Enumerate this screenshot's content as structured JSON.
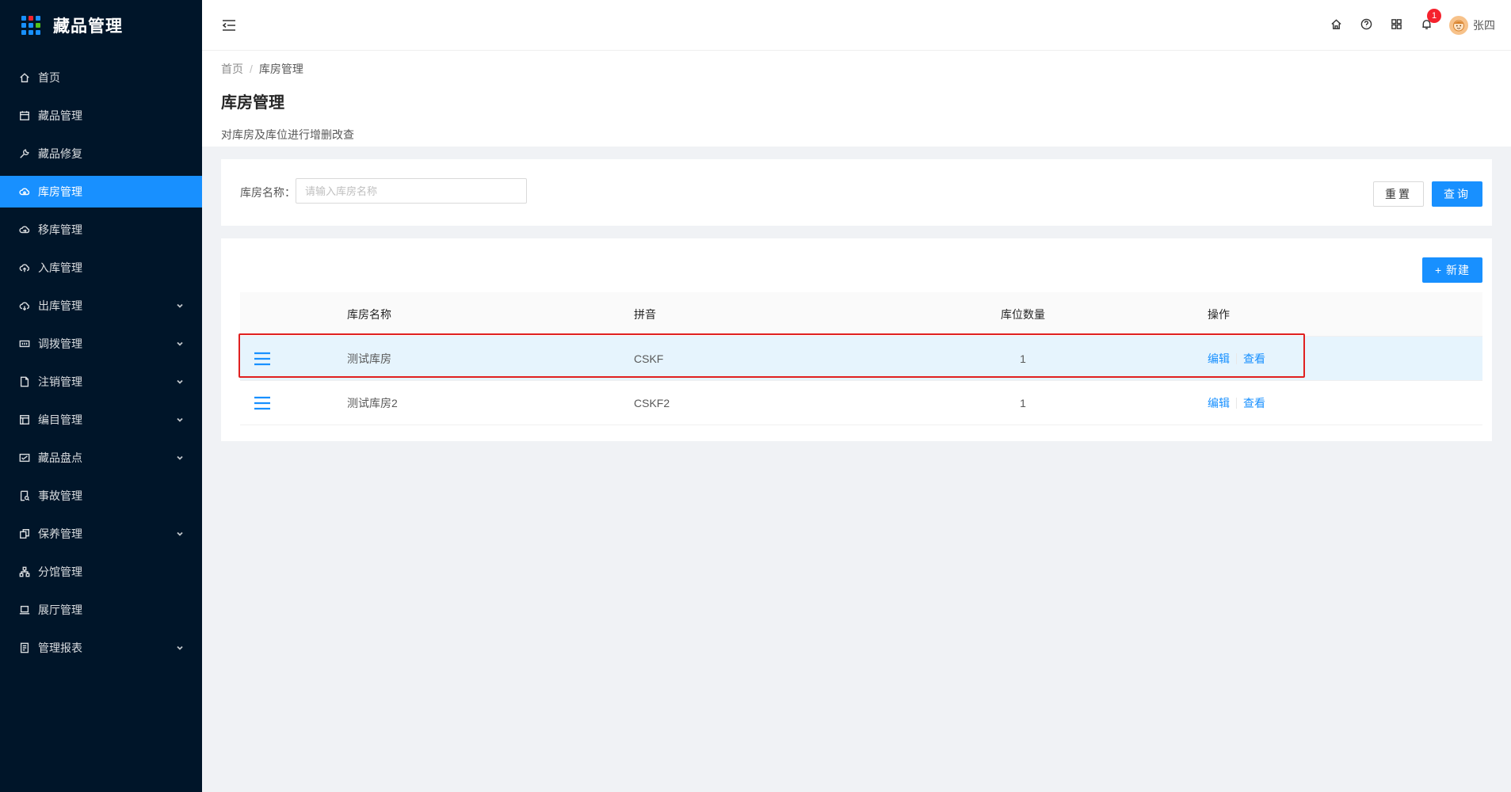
{
  "app": {
    "title": "藏品管理"
  },
  "sidebar": {
    "items": [
      {
        "label": "首页",
        "icon": "home-icon",
        "has_arrow": false,
        "active": false
      },
      {
        "label": "藏品管理",
        "icon": "calendar-icon",
        "has_arrow": false,
        "active": false
      },
      {
        "label": "藏品修复",
        "icon": "wrench-icon",
        "has_arrow": false,
        "active": false
      },
      {
        "label": "库房管理",
        "icon": "cloud-icon",
        "has_arrow": false,
        "active": true
      },
      {
        "label": "移库管理",
        "icon": "cloud-sync-icon",
        "has_arrow": false,
        "active": false
      },
      {
        "label": "入库管理",
        "icon": "cloud-upload-icon",
        "has_arrow": false,
        "active": false
      },
      {
        "label": "出库管理",
        "icon": "cloud-download-icon",
        "has_arrow": true,
        "active": false
      },
      {
        "label": "调拨管理",
        "icon": "transfer-icon",
        "has_arrow": true,
        "active": false
      },
      {
        "label": "注销管理",
        "icon": "file-icon",
        "has_arrow": true,
        "active": false
      },
      {
        "label": "编目管理",
        "icon": "catalog-icon",
        "has_arrow": true,
        "active": false
      },
      {
        "label": "藏品盘点",
        "icon": "inventory-icon",
        "has_arrow": true,
        "active": false
      },
      {
        "label": "事故管理",
        "icon": "file-search-icon",
        "has_arrow": false,
        "active": false
      },
      {
        "label": "保养管理",
        "icon": "maintain-icon",
        "has_arrow": true,
        "active": false
      },
      {
        "label": "分馆管理",
        "icon": "cluster-icon",
        "has_arrow": false,
        "active": false
      },
      {
        "label": "展厅管理",
        "icon": "laptop-icon",
        "has_arrow": false,
        "active": false
      },
      {
        "label": "管理报表",
        "icon": "report-icon",
        "has_arrow": true,
        "active": false
      }
    ]
  },
  "header": {
    "notification_count": "1",
    "username": "张四"
  },
  "breadcrumb": {
    "home": "首页",
    "sep": "/",
    "current": "库房管理"
  },
  "page": {
    "title": "库房管理",
    "description": "对库房及库位进行增删改查"
  },
  "search": {
    "label": "库房名称：",
    "placeholder": "请输入库房名称",
    "value": "",
    "reset_label": "重置",
    "query_label": "查询"
  },
  "table": {
    "new_label": "+ 新建",
    "columns": {
      "name": "库房名称",
      "pinyin": "拼音",
      "count": "库位数量",
      "op": "操作"
    },
    "rows": [
      {
        "name": "测试库房",
        "pinyin": "CSKF",
        "count": "1",
        "edit": "编辑",
        "view": "查看"
      },
      {
        "name": "测试库房2",
        "pinyin": "CSKF2",
        "count": "1",
        "edit": "编辑",
        "view": "查看"
      }
    ]
  },
  "colors": {
    "primary": "#1890ff",
    "sidebar_bg": "#001529",
    "highlight": "#e02020"
  }
}
